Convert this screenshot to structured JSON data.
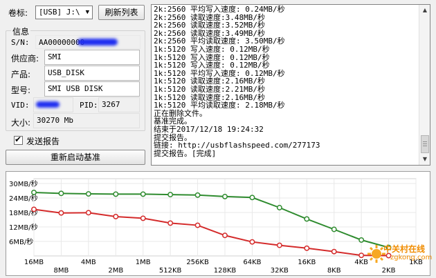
{
  "volume": {
    "label": "卷标:",
    "selected": "[USB] J:\\",
    "refresh_label": "刷新列表"
  },
  "info": {
    "title": "信息",
    "sn_label": "S/N:",
    "sn_value": "AA00000000",
    "vendor_label": "供应商:",
    "vendor_value": "SMI",
    "product_label": "产品:",
    "product_value": "USB_DISK",
    "model_label": "型号:",
    "model_value": "SMI USB DISK",
    "vid_label": "VID:",
    "vid_value": "",
    "pid_label": "PID:",
    "pid_value": "3267",
    "size_label": "大小:",
    "size_value": "30270 Mb"
  },
  "options": {
    "send_report_label": "发送报告",
    "send_report_checked": true,
    "restart_label": "重新启动基准"
  },
  "log": {
    "lines": [
      "2k:2560 平均写入速度: 0.24MB/秒",
      "2k:2560 读取速度:3.48MB/秒",
      "2k:2560 读取速度:3.52MB/秒",
      "2k:2560 读取速度:3.49MB/秒",
      "2k:2560 平均读取速度: 3.50MB/秒",
      "1k:5120 写入速度: 0.12MB/秒",
      "1k:5120 写入速度: 0.12MB/秒",
      "1k:5120 写入速度: 0.12MB/秒",
      "1k:5120 平均写入速度: 0.12MB/秒",
      "1k:5120 读取速度:2.16MB/秒",
      "1k:5120 读取速度:2.21MB/秒",
      "1k:5120 读取速度:2.16MB/秒",
      "1k:5120 平均读取速度: 2.18MB/秒",
      "正在删除文件。",
      "基准完成。",
      "结束于2017/12/18 19:24:32",
      "提交报告。",
      "链接: http://usbflashspeed.com/277173",
      "提交报告。[完成]"
    ]
  },
  "chart_data": {
    "type": "line",
    "y_tick_labels": [
      "30MB/秒",
      "24MB/秒",
      "18MB/秒",
      "12MB/秒",
      "6MB/秒"
    ],
    "y_ticks": [
      30,
      24,
      18,
      12,
      6
    ],
    "ylim": [
      0,
      32
    ],
    "categories": [
      "16MB",
      "8MB",
      "4MB",
      "2MB",
      "1MB",
      "512KB",
      "256KB",
      "128KB",
      "64KB",
      "32KB",
      "16KB",
      "8KB",
      "4KB",
      "2KB",
      "1KB"
    ],
    "series": [
      {
        "color": "#2e8b2e",
        "values": [
          26.3,
          25.9,
          25.7,
          25.6,
          25.6,
          25.4,
          25.2,
          24.6,
          24.2,
          20.0,
          15.3,
          11.0,
          6.6,
          3.5,
          null
        ]
      },
      {
        "color": "#d42a2a",
        "values": [
          19.3,
          17.8,
          17.9,
          16.3,
          15.6,
          13.6,
          12.7,
          8.5,
          5.8,
          4.4,
          3.2,
          1.8,
          0.24,
          0.12,
          null
        ]
      }
    ],
    "grid": true,
    "grid_color": "#e8e8e8"
  },
  "watermark": {
    "text_top": "中关村在线",
    "text_bottom": "zgkong.com"
  }
}
